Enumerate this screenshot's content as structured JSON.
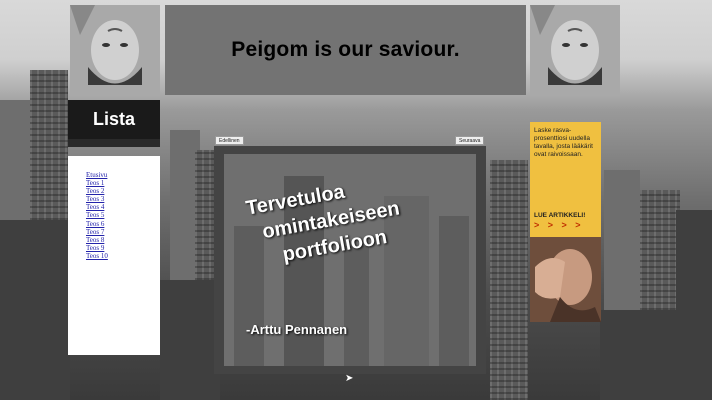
{
  "header": {
    "title": "Peigom is our saviour."
  },
  "sidebar": {
    "title": "Lista",
    "links": [
      "Etusivu",
      "Teos 1",
      "Teos 2",
      "Teos 3",
      "Teos 4",
      "Teos 5",
      "Teos 6",
      "Teos 7",
      "Teos 8",
      "Teos 9",
      "Teos 10"
    ]
  },
  "main": {
    "prev_label": "Edellinen",
    "next_label": "Seuraava",
    "welcome_lines": [
      "Tervetuloa",
      "omintakeiseen",
      "portfolioon"
    ],
    "author": "-Arttu Pennanen"
  },
  "ad": {
    "text": "Laske rasva-prosenttiosi uudella tavalla, josta lääkärit ovat raivoissaan.",
    "cta": "LUE ARTIKKELI!",
    "arrows": "> > > >"
  },
  "colors": {
    "header_bg": "#737373",
    "ad_bg": "#f0c040",
    "link": "#2222aa"
  }
}
